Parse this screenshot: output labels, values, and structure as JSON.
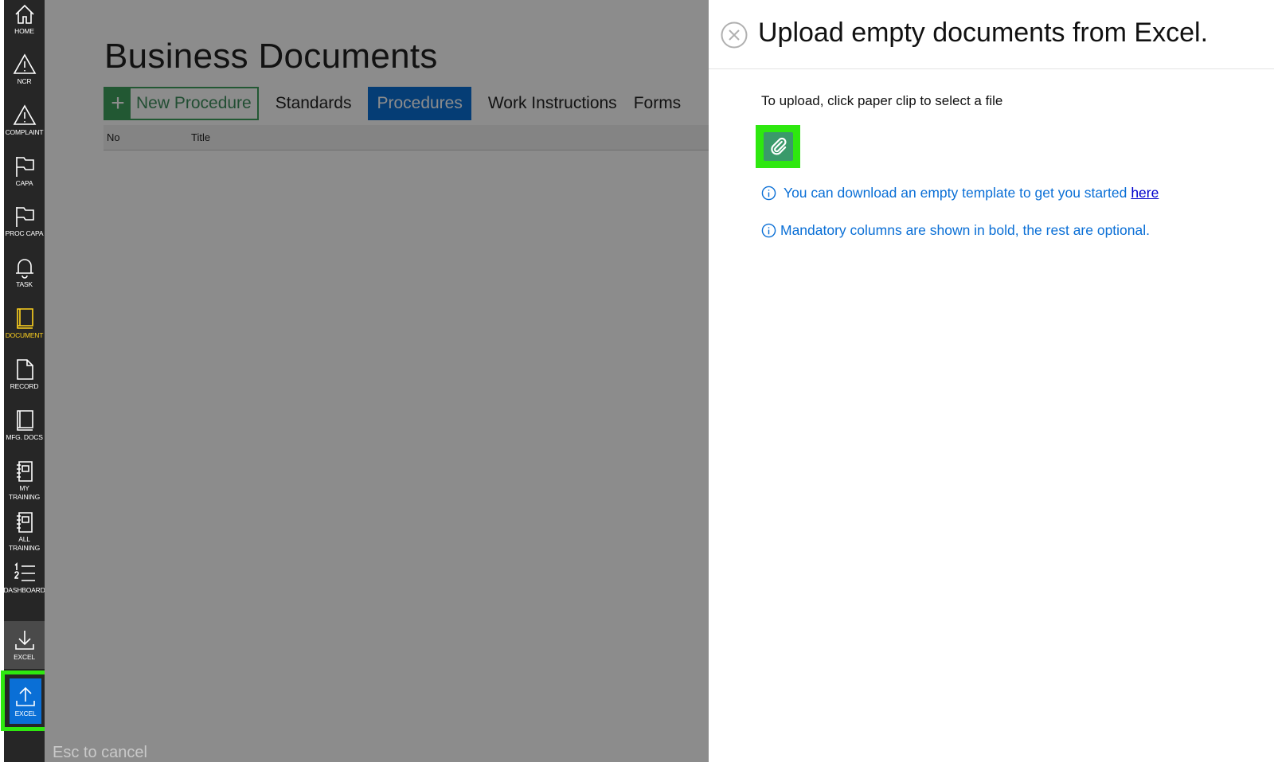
{
  "sidebar": {
    "items": [
      {
        "label": "HOME",
        "icon": "home-icon"
      },
      {
        "label": "NCR",
        "icon": "warning-icon"
      },
      {
        "label": "COMPLAINT",
        "icon": "warning-icon"
      },
      {
        "label": "CAPA",
        "icon": "flag-icon"
      },
      {
        "label": "PROC CAPA",
        "icon": "flag-icon"
      },
      {
        "label": "TASK",
        "icon": "bell-icon"
      },
      {
        "label": "DOCUMENT",
        "icon": "book-icon"
      },
      {
        "label": "RECORD",
        "icon": "file-icon"
      },
      {
        "label": "MFG. DOCS",
        "icon": "book-icon"
      },
      {
        "label": "MY\nTRAINING",
        "icon": "notebook-icon"
      },
      {
        "label": "ALL\nTRAINING",
        "icon": "notebook-icon"
      },
      {
        "label": "DASHBOARD",
        "icon": "numbered-list-icon"
      },
      {
        "label": "EXCEL",
        "icon": "download-icon"
      },
      {
        "label": "EXCEL",
        "icon": "upload-icon"
      }
    ],
    "active_color": "#ffd21f",
    "upload_highlight_color": "#2ee80f"
  },
  "main": {
    "title": "Business Documents",
    "new_button_label": "New Procedure",
    "tabs": [
      "Standards",
      "Procedures",
      "Work Instructions",
      "Forms"
    ],
    "active_tab": "Procedures",
    "table_columns": [
      "No",
      "Title"
    ],
    "esc_hint": "Esc to cancel"
  },
  "panel": {
    "title": "Upload empty documents from Excel.",
    "instruction": "To upload, click paper clip to select a file",
    "info_template": "You can download an empty template to get you started",
    "info_template_link": "here",
    "info_mandatory": "Mandatory columns are shown in bold, the rest are optional.",
    "accent_color": "#0a6fd6",
    "attach_button_color": "#3a9a6a"
  }
}
